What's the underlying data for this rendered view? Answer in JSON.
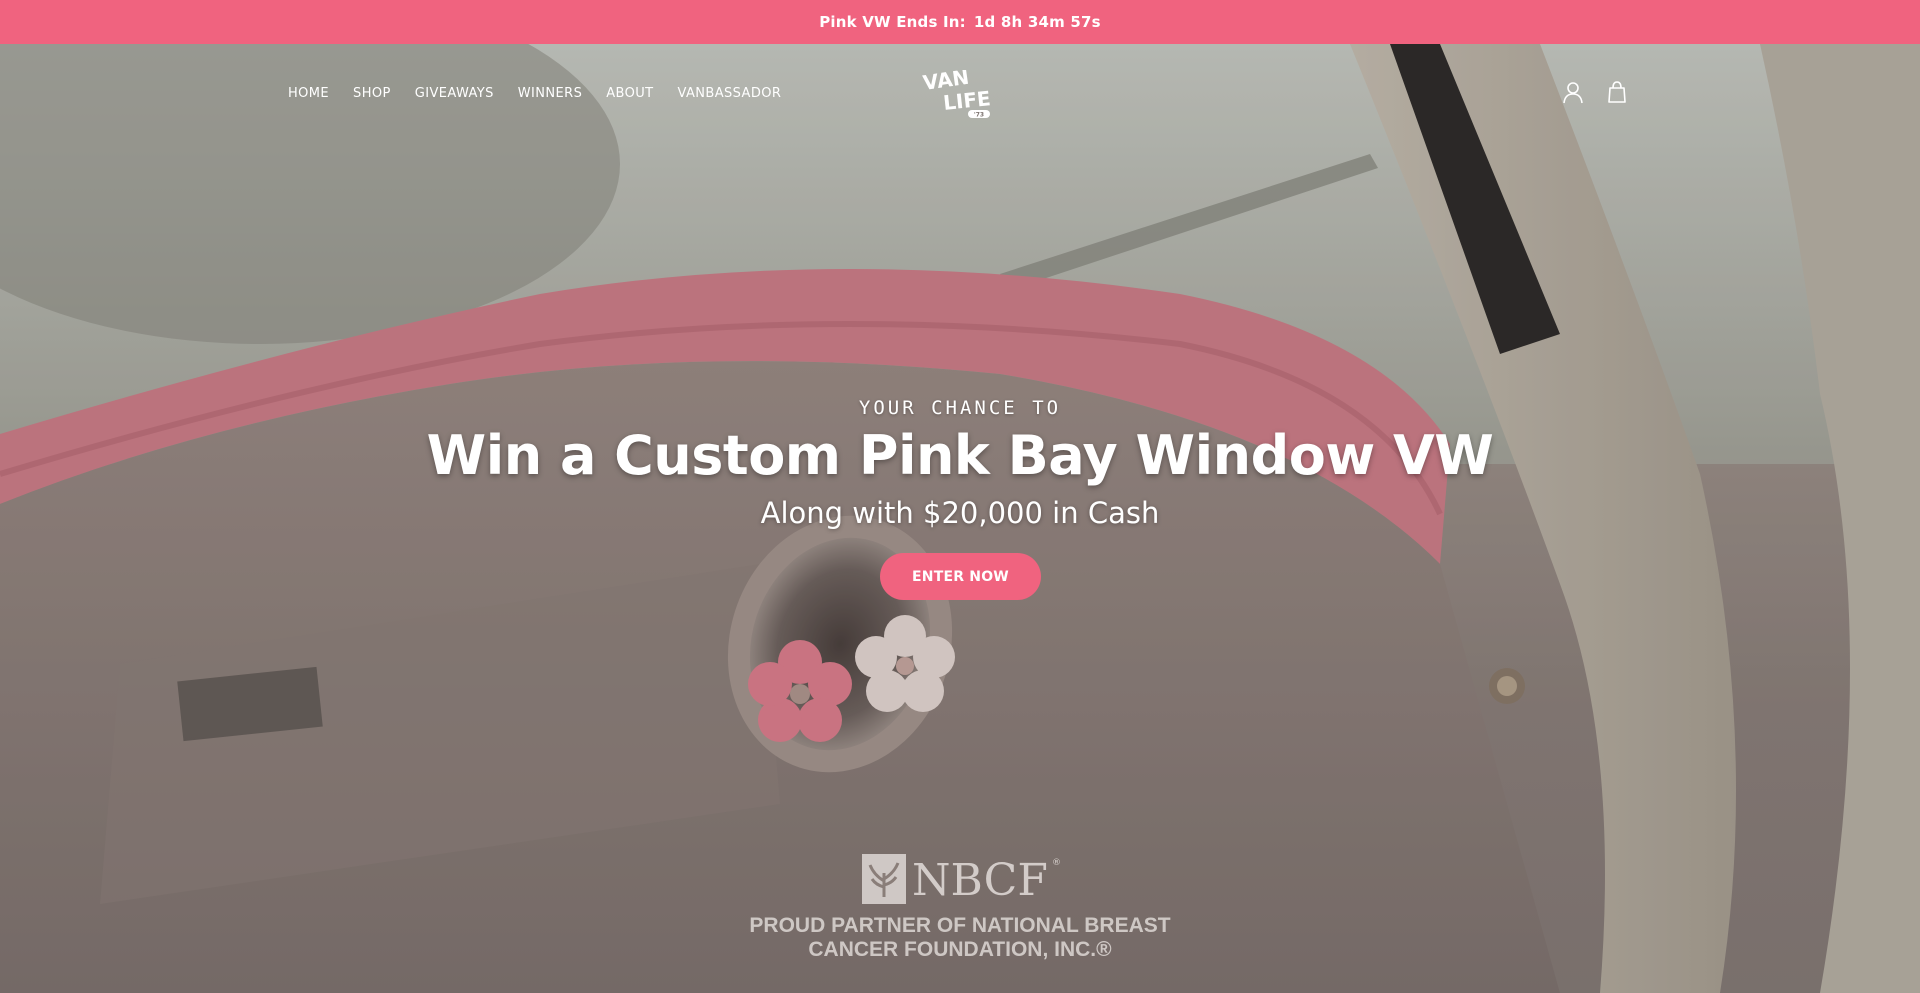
{
  "announcement": {
    "label": "Pink VW Ends In:",
    "countdown": "1d 8h 34m 57s",
    "background_color": "#f0637f"
  },
  "header": {
    "logo_text": [
      "VAN",
      "LIFE"
    ],
    "logo_badge": "'73",
    "nav": [
      {
        "label": "HOME"
      },
      {
        "label": "SHOP"
      },
      {
        "label": "GIVEAWAYS"
      },
      {
        "label": "WINNERS"
      },
      {
        "label": "ABOUT"
      },
      {
        "label": "VANBASSADOR"
      }
    ],
    "icons": [
      "account-icon",
      "cart-icon"
    ]
  },
  "hero": {
    "eyebrow": "YOUR CHANCE TO",
    "headline": "Win a Custom Pink Bay Window VW",
    "subhead": "Along with $20,000 in Cash",
    "cta_label": "ENTER NOW",
    "cta_color": "#f0637f"
  },
  "partner": {
    "logo_text": "NBCF",
    "logo_mark": "®",
    "text_line1": "PROUD PARTNER OF NATIONAL BREAST",
    "text_line2": "CANCER FOUNDATION, INC.®"
  }
}
